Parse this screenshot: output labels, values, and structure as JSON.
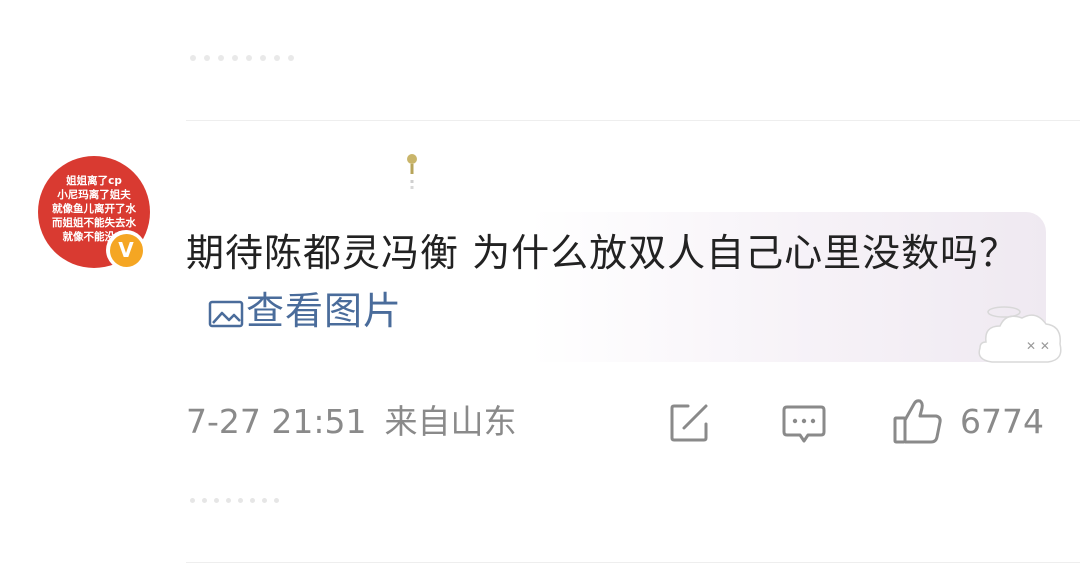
{
  "comment": {
    "avatar": {
      "lines": [
        "姐姐离了cp",
        "小尼玛离了姐夫",
        "就像鱼儿离开了水",
        "而姐姐不能失去水",
        "就像不能没有"
      ],
      "background_color": "#d93a31",
      "verified_badge_icon": "verified-v-icon",
      "verified_badge_letter": "V",
      "verified_badge_color": "#f5a623"
    },
    "text": "期待陈都灵冯衡 为什么放双人自己心里没数吗？",
    "view_image_label": "查看图片",
    "view_image_icon": "image-icon",
    "link_color": "#4a6c9b",
    "timestamp": "7-27 21:51",
    "location": "来自山东",
    "actions": {
      "repost_icon": "repost-edit-icon",
      "comment_icon": "comment-bubble-icon",
      "like_icon": "thumbs-up-icon",
      "like_count": "6774"
    }
  }
}
